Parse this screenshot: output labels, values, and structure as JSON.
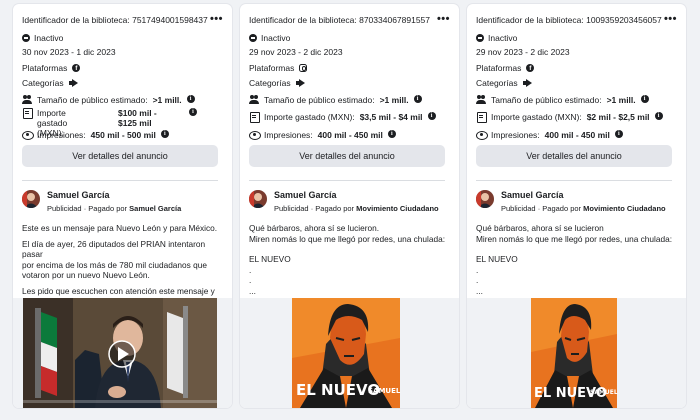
{
  "cards": [
    {
      "library_id": "Identificador de la biblioteca: 7517494001598437",
      "more": "•••",
      "status": "Inactivo",
      "dates": "30 nov 2023 - 1 dic 2023",
      "platforms_label": "Plataformas",
      "platform_icon": "facebook-icon",
      "categories_label": "Categorías",
      "audience_label": "Tamaño de público estimado:",
      "audience_value": ">1 mill.",
      "spend_label": "Importe gastado (MXN):",
      "spend_value": "$100 mil - $125 mil",
      "impressions_label": "Impresiones:",
      "impressions_value": "450 mil - 500 mil",
      "details_button": "Ver detalles del anuncio",
      "advertiser": "Samuel García",
      "sponsored": "Publicidad",
      "paid_by_prefix": " · Pagado por ",
      "paid_by": "Samuel García",
      "body_lines": [
        "Este es un mensaje para Nuevo León y para México.",
        "",
        "El día de ayer, 26 diputados del PRIAN intentaron pasar",
        "por encima de los más de 780 mil ciudadanos que",
        "votaron por un nuevo Nuevo León.",
        "",
        "Les pido que escuchen con atención este mensaje y qu..."
      ],
      "media_type": "video"
    },
    {
      "library_id": "Identificador de la biblioteca: 870334067891557",
      "more": "•••",
      "status": "Inactivo",
      "dates": "29 nov 2023 - 2 dic 2023",
      "platforms_label": "Plataformas",
      "platform_icon": "instagram-icon",
      "categories_label": "Categorías",
      "audience_label": "Tamaño de público estimado:",
      "audience_value": ">1 mill.",
      "spend_label": "Importe gastado (MXN):",
      "spend_value": "$3,5 mil - $4 mil",
      "impressions_label": "Impresiones:",
      "impressions_value": "400 mil - 450 mil",
      "details_button": "Ver detalles del anuncio",
      "advertiser": "Samuel García",
      "sponsored": "Publicidad",
      "paid_by_prefix": " · Pagado por ",
      "paid_by": "Movimiento Ciudadano",
      "body_lines": [
        "Qué bárbaros, ahora sí se lucieron.",
        "Miren nomás lo que me llegó por redes, una chulada:",
        "",
        "EL NUEVO",
        ".",
        ".",
        "..."
      ],
      "media_type": "poster",
      "poster_title": "EL NUEVO",
      "poster_brand": "SAMUEL"
    },
    {
      "library_id": "Identificador de la biblioteca: 1009359203456057",
      "more": "•••",
      "status": "Inactivo",
      "dates": "29 nov 2023 - 2 dic 2023",
      "platforms_label": "Plataformas",
      "platform_icon": "facebook-icon",
      "categories_label": "Categorías",
      "audience_label": "Tamaño de público estimado:",
      "audience_value": ">1 mill.",
      "spend_label": "Importe gastado (MXN):",
      "spend_value": "$2 mil - $2,5 mil",
      "impressions_label": "Impresiones:",
      "impressions_value": "400 mil - 450 mil",
      "details_button": "Ver detalles del anuncio",
      "advertiser": "Samuel García",
      "sponsored": "Publicidad",
      "paid_by_prefix": " · Pagado por ",
      "paid_by": "Movimiento Ciudadano",
      "body_lines": [
        "Qué bárbaros, ahora sí se lucieron",
        "Miren nomás lo que me llegó por redes, una chulada:",
        "",
        "EL NUEVO",
        ".",
        ".",
        "..."
      ],
      "media_type": "poster",
      "poster_title": "EL NUEVO",
      "poster_brand": "SAMUEL"
    }
  ]
}
